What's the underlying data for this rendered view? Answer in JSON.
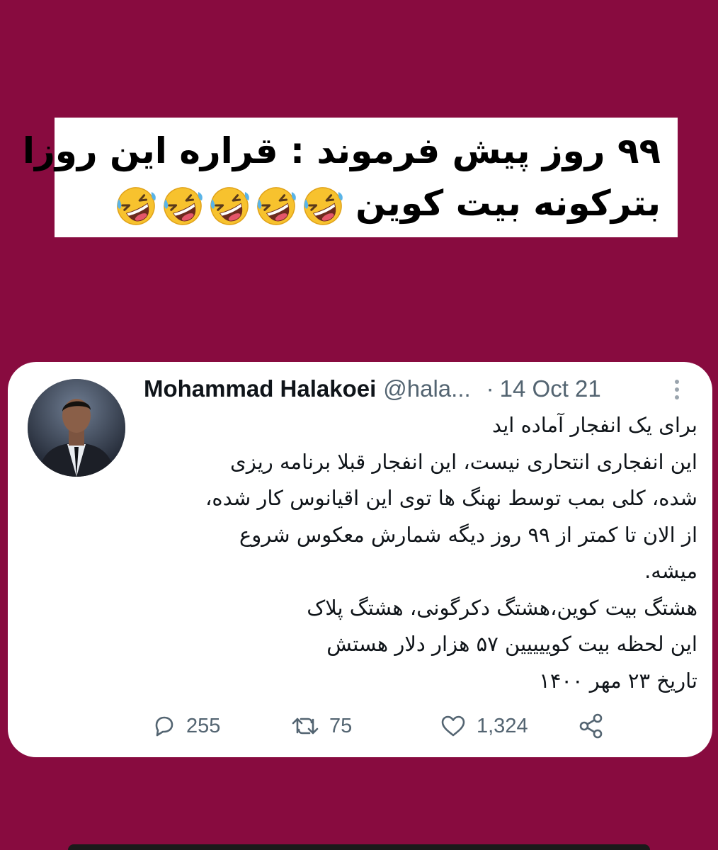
{
  "caption": {
    "line1": "۹۹ روز پیش فرموند : قراره این روزا",
    "line2": "بترکونه بیت کوین",
    "emoji": "rolling-on-floor-laughing-emoji",
    "emoji_count": 5
  },
  "tweet": {
    "author_name": "Mohammad Halakoei",
    "author_handle": "@hala...",
    "separator": "·",
    "date": "14 Oct 21",
    "body_lines": [
      "برای یک انفجار آماده اید",
      "این انفجاری انتحاری نیست، این انفجار قبلا برنامه ریزی",
      "شده، کلی بمب توسط نهنگ ها توی این اقیانوس کار شده،",
      "از الان تا کمتر از ۹۹ روز دیگه شمارش معکوس شروع",
      "میشه.",
      "هشتگ بیت کوین،هشتگ دکرگونی، هشتگ پلاک",
      "این لحظه بیت کوییییین ۵۷ هزار دلار هستش",
      "تاریخ ۲۳ مهر ۱۴۰۰"
    ],
    "replies": "255",
    "retweets": "75",
    "likes": "1,324",
    "icons": [
      "reply-icon",
      "retweet-icon",
      "like-icon",
      "share-icon",
      "more-options-icon"
    ]
  },
  "colors": {
    "background": "#880b3f",
    "card": "#ffffff",
    "secondary_text": "#536471"
  }
}
